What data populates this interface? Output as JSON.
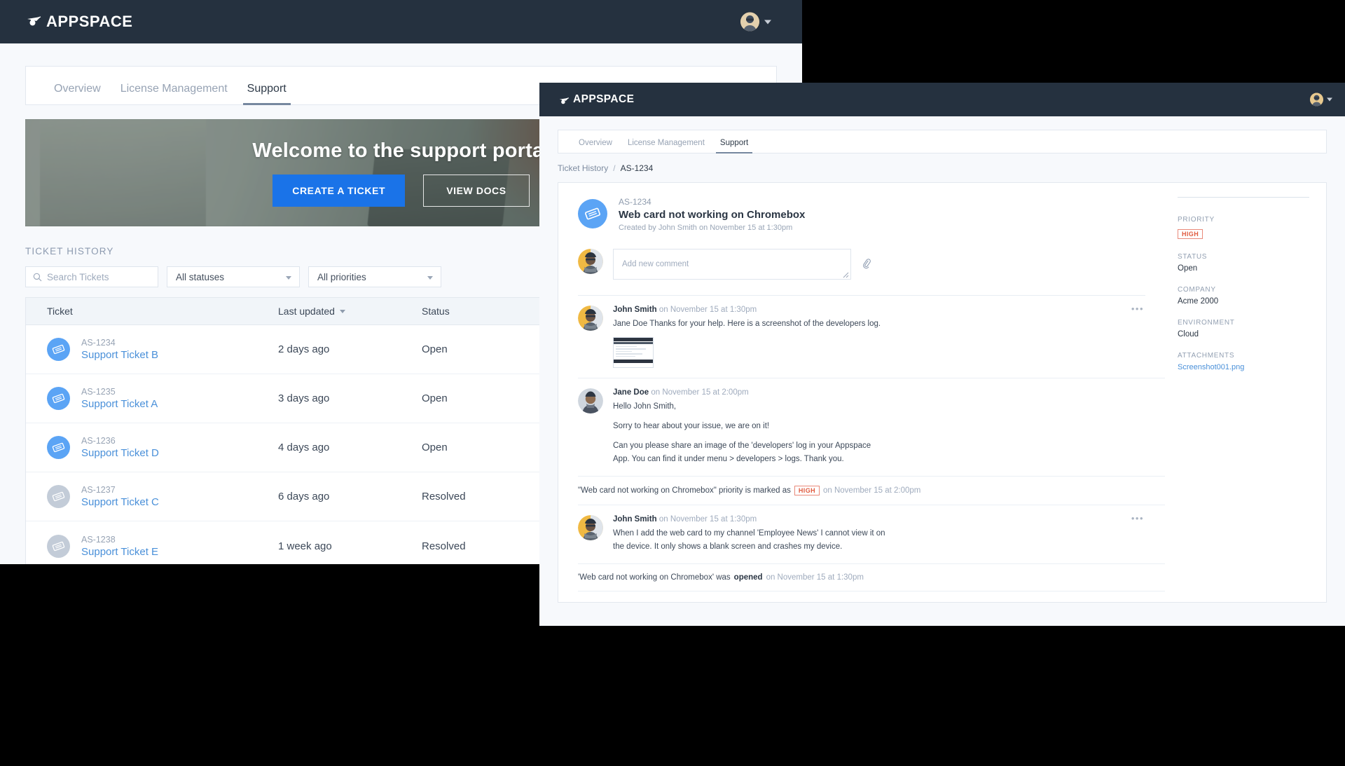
{
  "brand": {
    "name": "APPSPACE",
    "accent": "#1a73e8",
    "topbar_bg": "#25313f"
  },
  "background_window": {
    "tabs": [
      {
        "label": "Overview",
        "active": false
      },
      {
        "label": "License Management",
        "active": false
      },
      {
        "label": "Support",
        "active": true
      }
    ],
    "hero": {
      "title": "Welcome to the support portal",
      "primary_button": "CREATE A TICKET",
      "secondary_button": "VIEW DOCS"
    },
    "section_title": "TICKET HISTORY",
    "filters": {
      "search_placeholder": "Search Tickets",
      "search_value": "",
      "status_select": "All statuses",
      "priority_select": "All priorities"
    },
    "table": {
      "columns": [
        "Ticket",
        "Last updated",
        "Status"
      ],
      "sort_column": "Last updated",
      "rows": [
        {
          "id": "AS-1234",
          "name": "Support Ticket B",
          "updated": "2 days ago",
          "status": "Open",
          "state": "open"
        },
        {
          "id": "AS-1235",
          "name": "Support Ticket A",
          "updated": "3 days ago",
          "status": "Open",
          "state": "open"
        },
        {
          "id": "AS-1236",
          "name": "Support Ticket D",
          "updated": "4 days ago",
          "status": "Open",
          "state": "open"
        },
        {
          "id": "AS-1237",
          "name": "Support Ticket C",
          "updated": "6 days ago",
          "status": "Resolved",
          "state": "resolved"
        },
        {
          "id": "AS-1238",
          "name": "Support Ticket E",
          "updated": "1 week ago",
          "status": "Resolved",
          "state": "resolved"
        }
      ]
    }
  },
  "overlay_window": {
    "tabs": [
      {
        "label": "Overview",
        "active": false
      },
      {
        "label": "License Management",
        "active": false
      },
      {
        "label": "Support",
        "active": true
      }
    ],
    "breadcrumb": {
      "parent": "Ticket History",
      "separator": "/",
      "current": "AS-1234"
    },
    "ticket": {
      "id": "AS-1234",
      "title": "Web card not working on Chromebox",
      "created": "Created by John Smith on November 15 at 1:30pm"
    },
    "new_comment": {
      "placeholder": "Add new comment",
      "value": ""
    },
    "comments": [
      {
        "type": "comment",
        "author": "John Smith",
        "time": "on November 15 at 1:30pm",
        "paragraphs": [
          "Jane Doe Thanks for your help. Here is a screenshot of the developers log."
        ],
        "has_attachment_thumb": true,
        "has_menu": true
      },
      {
        "type": "comment",
        "author": "Jane Doe",
        "time": "on November 15 at 2:00pm",
        "paragraphs": [
          "Hello John Smith,",
          "Sorry to hear about your issue, we are on it!",
          "Can you please share an image of the 'developers' log in your Appspace App. You can find it under menu > developers > logs. Thank you."
        ],
        "has_attachment_thumb": false,
        "has_menu": false
      },
      {
        "type": "event",
        "quote": "\"Web card not working on Chromebox\" priority is marked as",
        "badge": "HIGH",
        "time": "on November 15 at 2:00pm"
      },
      {
        "type": "comment",
        "author": "John Smith",
        "time": "on November 15 at 1:30pm",
        "paragraphs": [
          "When I add the web card to my channel 'Employee News' I cannot view it on the device. It only shows a blank screen and crashes my device."
        ],
        "has_attachment_thumb": false,
        "has_menu": true
      },
      {
        "type": "event",
        "quote": "'Web card not working on Chromebox'  was",
        "bold": "opened",
        "time": "on November 15 at 1:30pm"
      }
    ],
    "sidebar": {
      "fields": [
        {
          "label": "PRIORITY",
          "value": "HIGH",
          "kind": "badge"
        },
        {
          "label": "STATUS",
          "value": "Open",
          "kind": "text"
        },
        {
          "label": "COMPANY",
          "value": "Acme 2000",
          "kind": "text"
        },
        {
          "label": "ENVIRONMENT",
          "value": "Cloud",
          "kind": "text"
        },
        {
          "label": "ATTACHMENTS",
          "value": "Screenshot001.png",
          "kind": "link"
        }
      ]
    }
  }
}
